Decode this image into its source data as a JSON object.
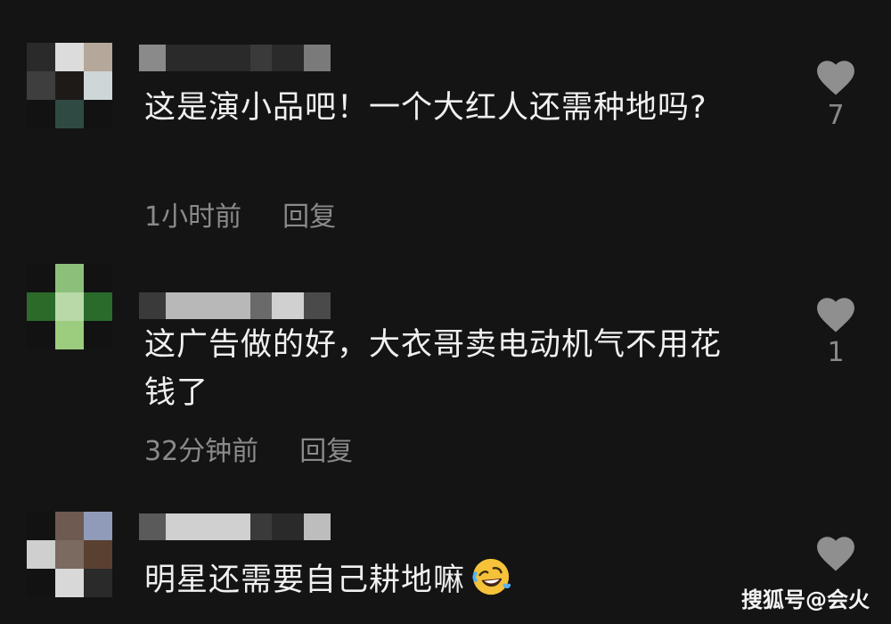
{
  "comments": [
    {
      "text": "这是演小品吧！一个大红人还需种地吗?",
      "time": "1小时前",
      "reply": "回复",
      "likes": "7",
      "avatar_colors": [
        "#2a2a2a",
        "#dcdcdc",
        "#b5a89a",
        "#3e3e3e",
        "#1e1a17",
        "#cfd6d8",
        "#121212",
        "#2f4a42",
        "#121212"
      ],
      "username_colors": [
        "#8a8a8a",
        "#2a2a2a",
        "#3a3a3a",
        "#2a2a2a",
        "#7a7a7a"
      ]
    },
    {
      "text": "这广告做的好，大衣哥卖电动机气不用花钱了",
      "time": "32分钟前",
      "reply": "回复",
      "likes": "1",
      "avatar_colors": [
        "#121212",
        "#8cc07a",
        "#121212",
        "#2c6a2a",
        "#b9d9a8",
        "#2a6b2c",
        "#121212",
        "#9ccc7e",
        "#121212"
      ],
      "username_colors": [
        "#3a3a3a",
        "#b8b8b8",
        "#6a6a6a",
        "#d0d0d0",
        "#4a4a4a"
      ]
    },
    {
      "text": "明星还需要自己耕地嘛",
      "emoji": "rofl-emoji",
      "time": "",
      "reply": "",
      "likes": "",
      "avatar_colors": [
        "#121212",
        "#6e5a50",
        "#8f9bb8",
        "#cfcfcf",
        "#7b6a60",
        "#5a4030",
        "#121212",
        "#d8d8d8",
        "#2a2a2a"
      ],
      "username_colors": [
        "#5a5a5a",
        "#d0d0d0",
        "#3a3a3a",
        "#2a2a2a",
        "#bdbdbd"
      ]
    }
  ],
  "watermark": "搜狐号@会火",
  "colors": {
    "background": "#141414",
    "text": "#f0f0f0",
    "muted": "#8a8a8a",
    "heart": "#8f8f8f"
  }
}
